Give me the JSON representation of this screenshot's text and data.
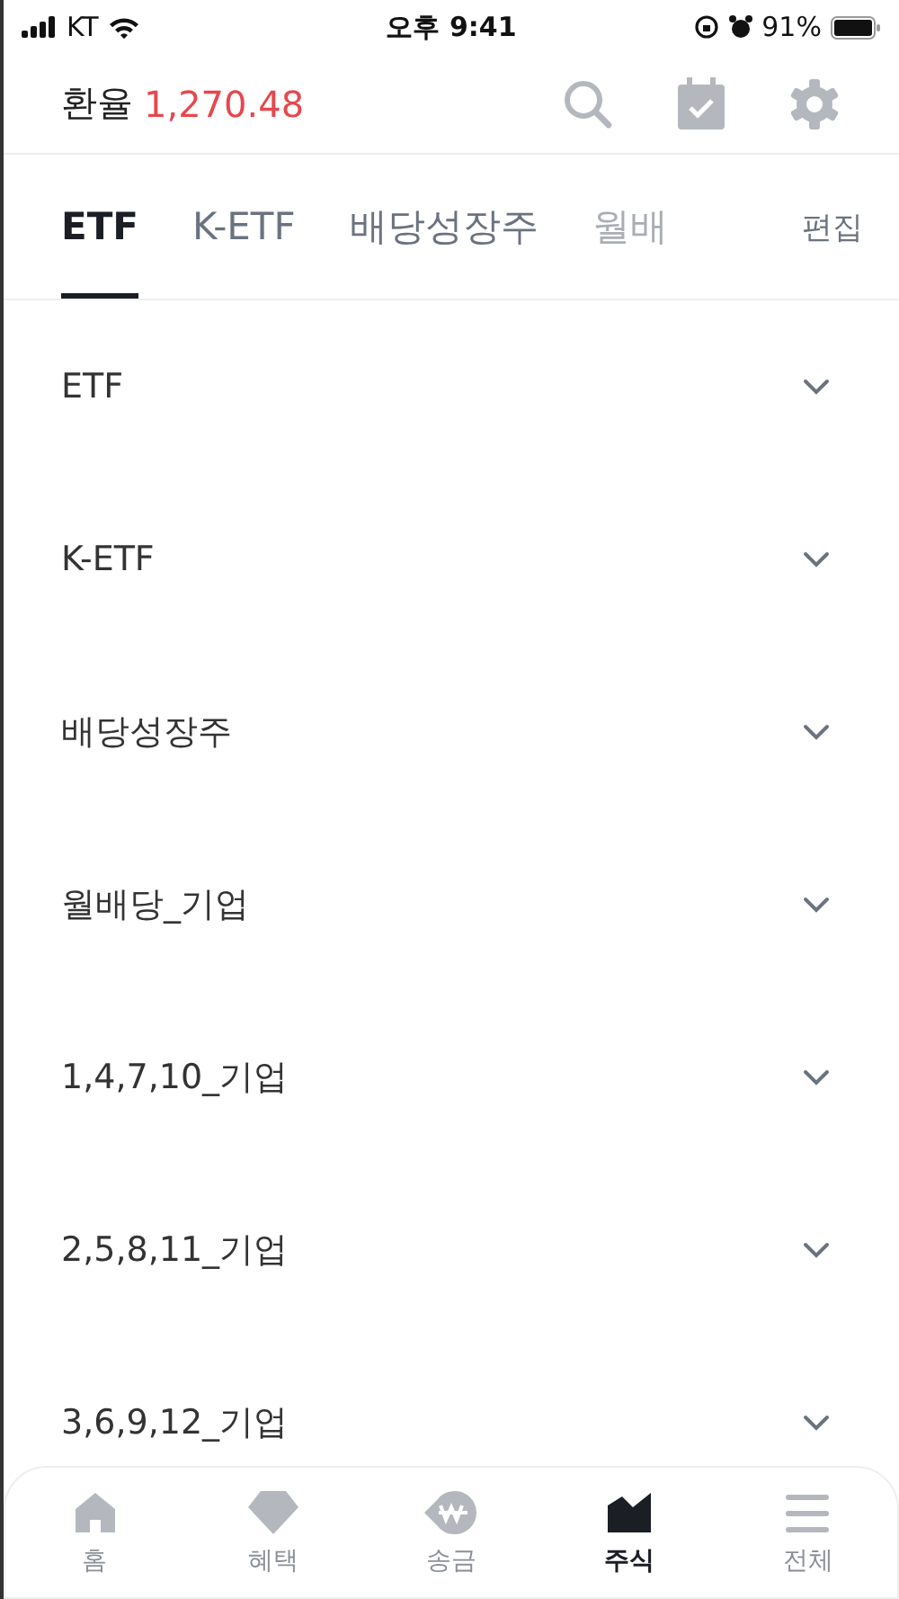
{
  "status_bar": {
    "carrier": "KT",
    "time": "오후 9:41",
    "battery": "91%"
  },
  "header": {
    "label": "환율",
    "rate": "1,270.48"
  },
  "tabs": [
    {
      "label": "ETF",
      "selected": true
    },
    {
      "label": "K-ETF",
      "selected": false
    },
    {
      "label": "배당성장주",
      "selected": false
    },
    {
      "label": "월배",
      "selected": false
    }
  ],
  "edit_label": "편집",
  "groups": [
    {
      "name": "ETF",
      "expanded": false
    },
    {
      "name": "K-ETF",
      "expanded": false
    },
    {
      "name": "배당성장주",
      "expanded": false
    },
    {
      "name": "월배당_기업",
      "expanded": false
    },
    {
      "name": "1,4,7,10_기업",
      "expanded": false
    },
    {
      "name": "2,5,8,11_기업",
      "expanded": false
    },
    {
      "name": "3,6,9,12_기업",
      "expanded": false
    }
  ],
  "nav": [
    {
      "kind": "home",
      "label": "홈",
      "selected": false
    },
    {
      "kind": "gem",
      "label": "혜택",
      "selected": false
    },
    {
      "kind": "won",
      "label": "송금",
      "selected": false
    },
    {
      "kind": "stock",
      "label": "주식",
      "selected": true
    },
    {
      "kind": "all",
      "label": "전체",
      "selected": false
    }
  ]
}
